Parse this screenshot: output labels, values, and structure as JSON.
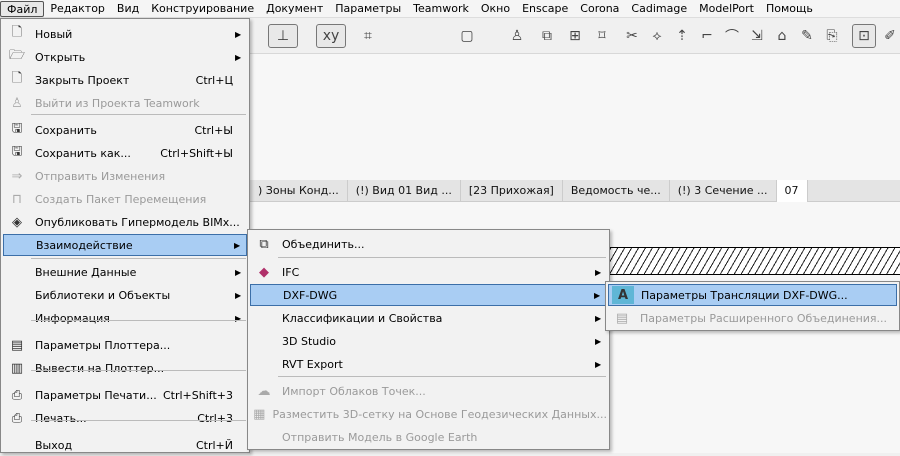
{
  "menubar": [
    "Файл",
    "Редактор",
    "Вид",
    "Конструирование",
    "Документ",
    "Параметры",
    "Teamwork",
    "Окно",
    "Enscape",
    "Corona",
    "Cadimage",
    "ModelPort",
    "Помощь"
  ],
  "tabs": [
    ") Зоны Конд...",
    "(!) Вид 01 Вид ...",
    "[23 Прихожая]",
    "Ведомость че...",
    "(!) 3 Сечение ...",
    "07"
  ],
  "file_menu": [
    {
      "label": "Новый",
      "icon": "new-file-icon",
      "arrow": true
    },
    {
      "label": "Открыть",
      "icon": "open-folder-icon",
      "arrow": true
    },
    {
      "label": "Закрыть Проект",
      "icon": "close-file-icon",
      "shortcut": "Ctrl+Ц"
    },
    {
      "label": "Выйти из Проекта Teamwork",
      "icon": "teamwork-leave-icon",
      "disabled": true
    },
    {
      "label": "Сохранить",
      "icon": "save-icon",
      "shortcut": "Ctrl+Ы"
    },
    {
      "label": "Сохранить как...",
      "icon": "save-as-icon",
      "shortcut": "Ctrl+Shift+Ы"
    },
    {
      "label": "Отправить Изменения",
      "icon": "send-icon",
      "disabled": true
    },
    {
      "label": "Создать Пакет Перемещения",
      "icon": "package-icon",
      "disabled": true
    },
    {
      "label": "Опубликовать Гипермодель BIMx...",
      "icon": "bimx-icon"
    },
    {
      "label": "Взаимодействие",
      "arrow": true,
      "highlighted": true
    },
    {
      "label": "Внешние Данные",
      "arrow": true
    },
    {
      "label": "Библиотеки и Объекты",
      "arrow": true
    },
    {
      "label": "Информация",
      "arrow": true
    },
    {
      "label": "Параметры Плоттера...",
      "icon": "plotter-settings-icon"
    },
    {
      "label": "Вывести на Плоттер...",
      "icon": "plotter-icon"
    },
    {
      "label": "Параметры Печати...",
      "icon": "print-settings-icon",
      "shortcut": "Ctrl+Shift+3"
    },
    {
      "label": "Печать...",
      "icon": "printer-icon",
      "shortcut": "Ctrl+3"
    },
    {
      "label": "Выход",
      "shortcut": "Ctrl+Й"
    }
  ],
  "interop_menu": [
    {
      "label": "Объединить...",
      "icon": "merge-icon"
    },
    {
      "label": "IFC",
      "icon": "ifc-icon",
      "arrow": true
    },
    {
      "label": "DXF-DWG",
      "arrow": true,
      "highlighted": true
    },
    {
      "label": "Классификации и Свойства",
      "arrow": true
    },
    {
      "label": "3D Studio",
      "arrow": true
    },
    {
      "label": "RVT Export",
      "arrow": true
    },
    {
      "label": "Импорт Облаков Точек...",
      "icon": "point-cloud-icon",
      "disabled": true
    },
    {
      "label": "Разместить 3D-сетку на Основе Геодезических Данных...",
      "icon": "survey-mesh-icon",
      "disabled": true
    },
    {
      "label": "Отправить Модель в Google Earth",
      "disabled": true
    }
  ],
  "dxf_menu": [
    {
      "label": "Параметры Трансляции DXF-DWG...",
      "icon": "dxf-translator-icon",
      "highlighted": true
    },
    {
      "label": "Параметры Расширенного Объединения...",
      "icon": "merge-settings-icon",
      "disabled": true
    }
  ],
  "colors": {
    "highlight": "#a9cdf3",
    "highlight_border": "#3c6fa8"
  }
}
